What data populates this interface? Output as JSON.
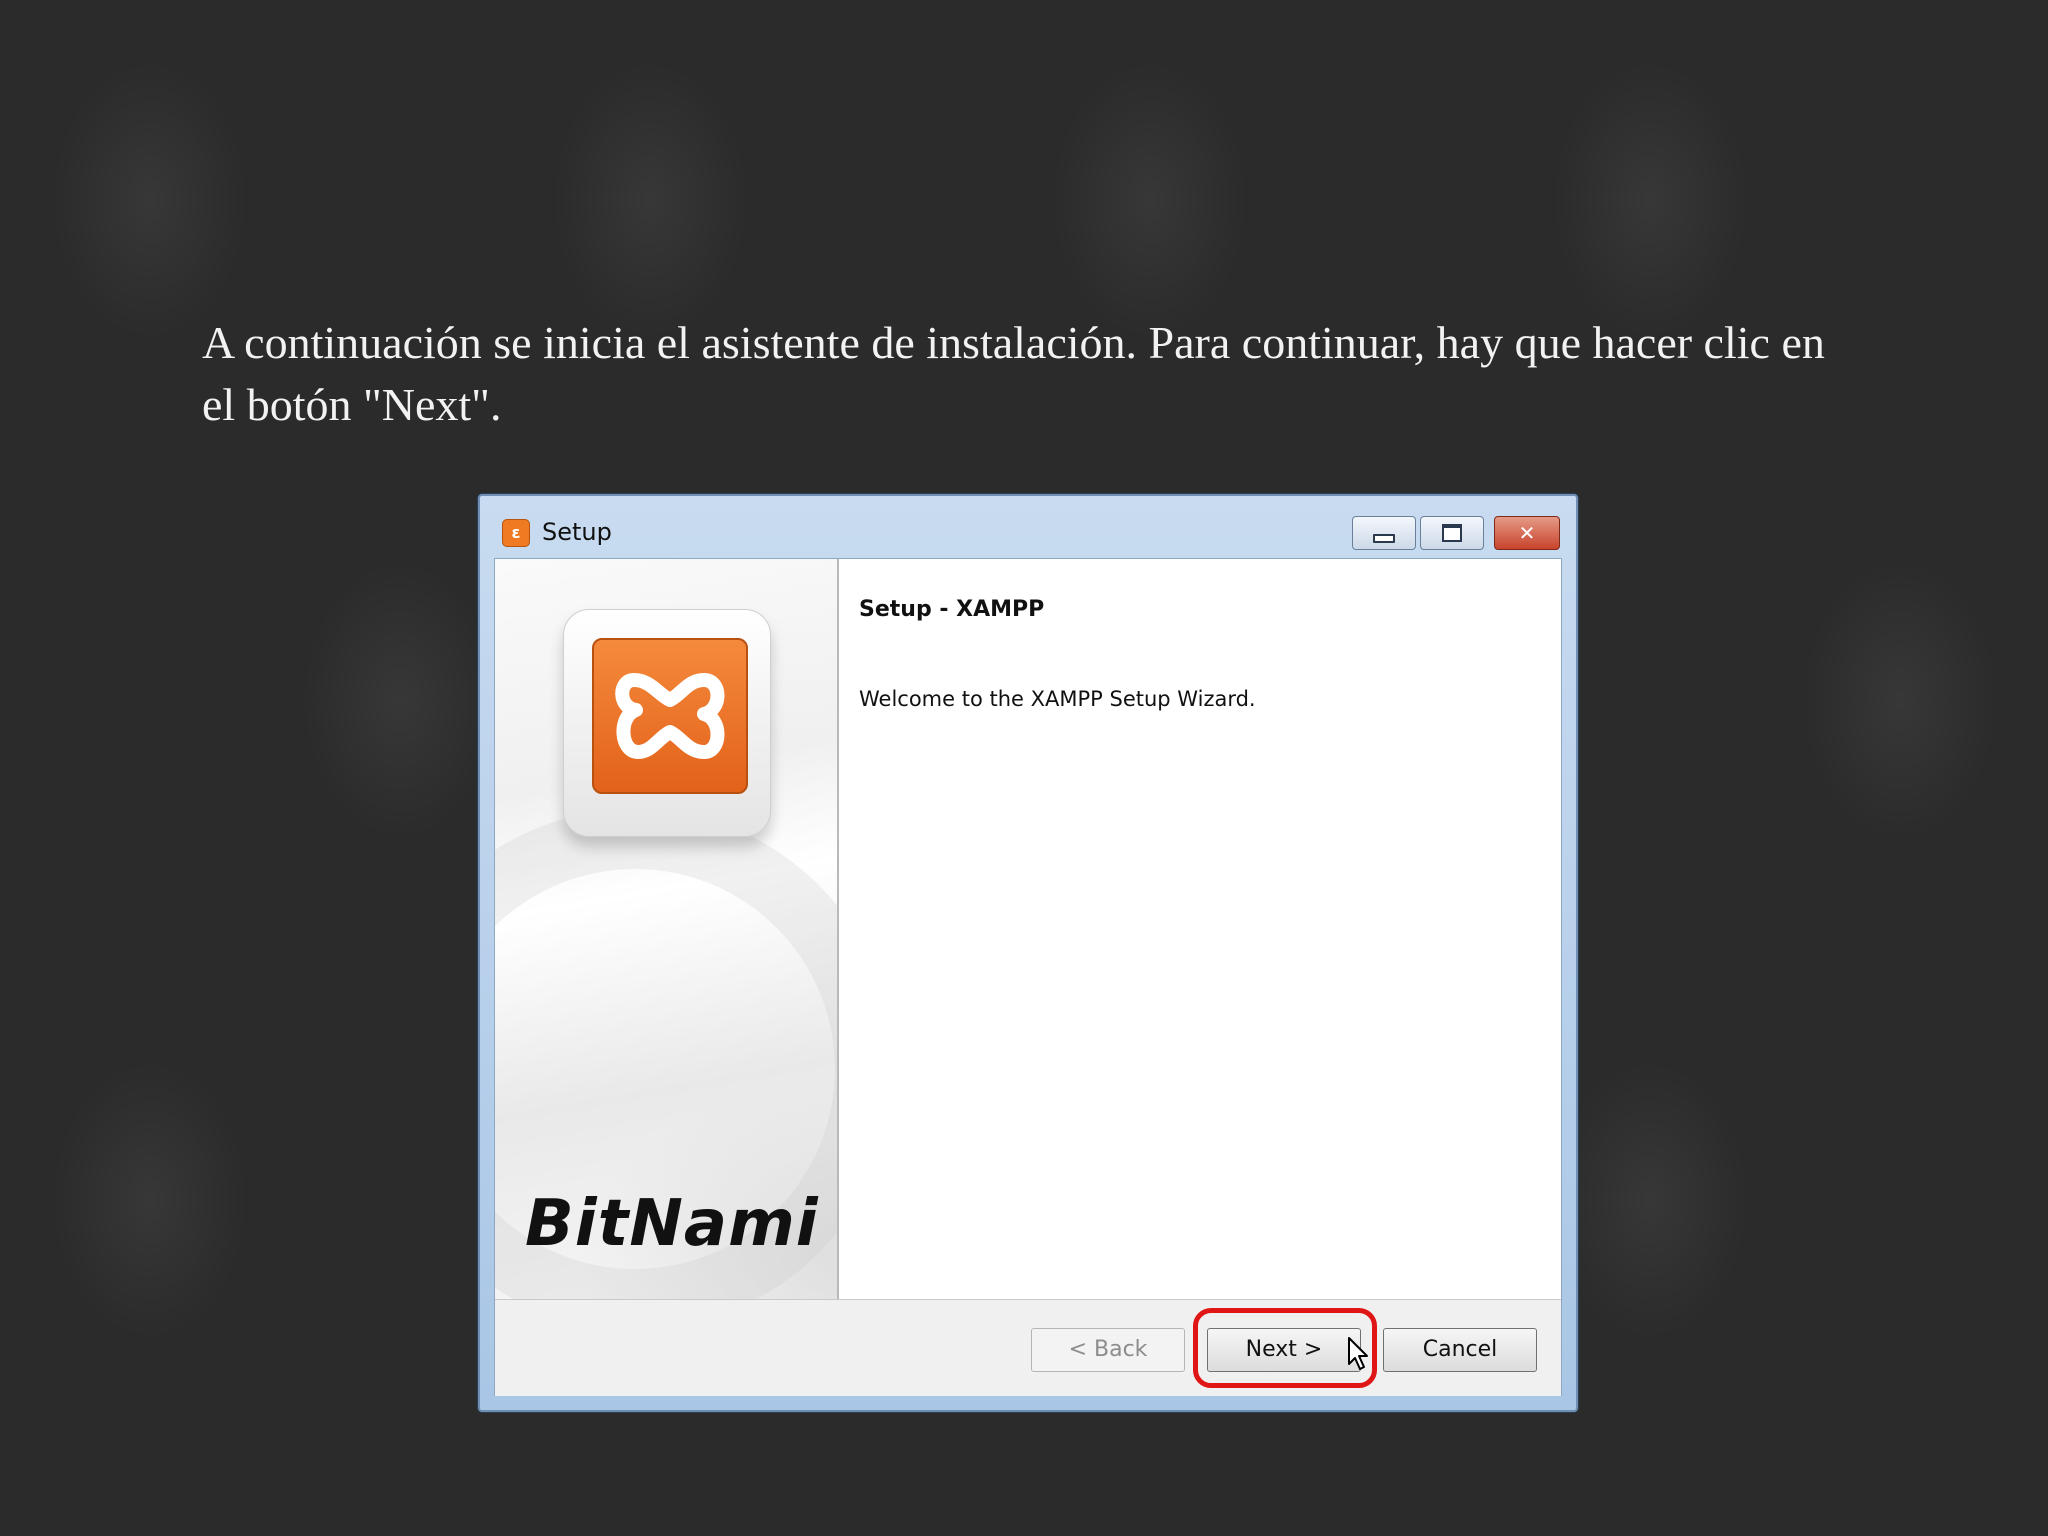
{
  "caption": "A continuación se inicia el asistente de instalación. Para continuar, hay que hacer clic en el botón \"Next\".",
  "window": {
    "title": "Setup",
    "app_icon": "xampp-icon",
    "controls": {
      "minimize": "minimize-icon",
      "maximize": "maximize-icon",
      "close": "close-icon"
    }
  },
  "sidebar": {
    "logo": "xampp-logo",
    "brand": "BitNami"
  },
  "content": {
    "heading": "Setup - XAMPP",
    "welcome": "Welcome to the XAMPP Setup Wizard."
  },
  "buttons": {
    "back": "< Back",
    "next": "Next >",
    "cancel": "Cancel"
  },
  "colors": {
    "highlight": "#e01515",
    "xampp_orange": "#f07a22"
  }
}
